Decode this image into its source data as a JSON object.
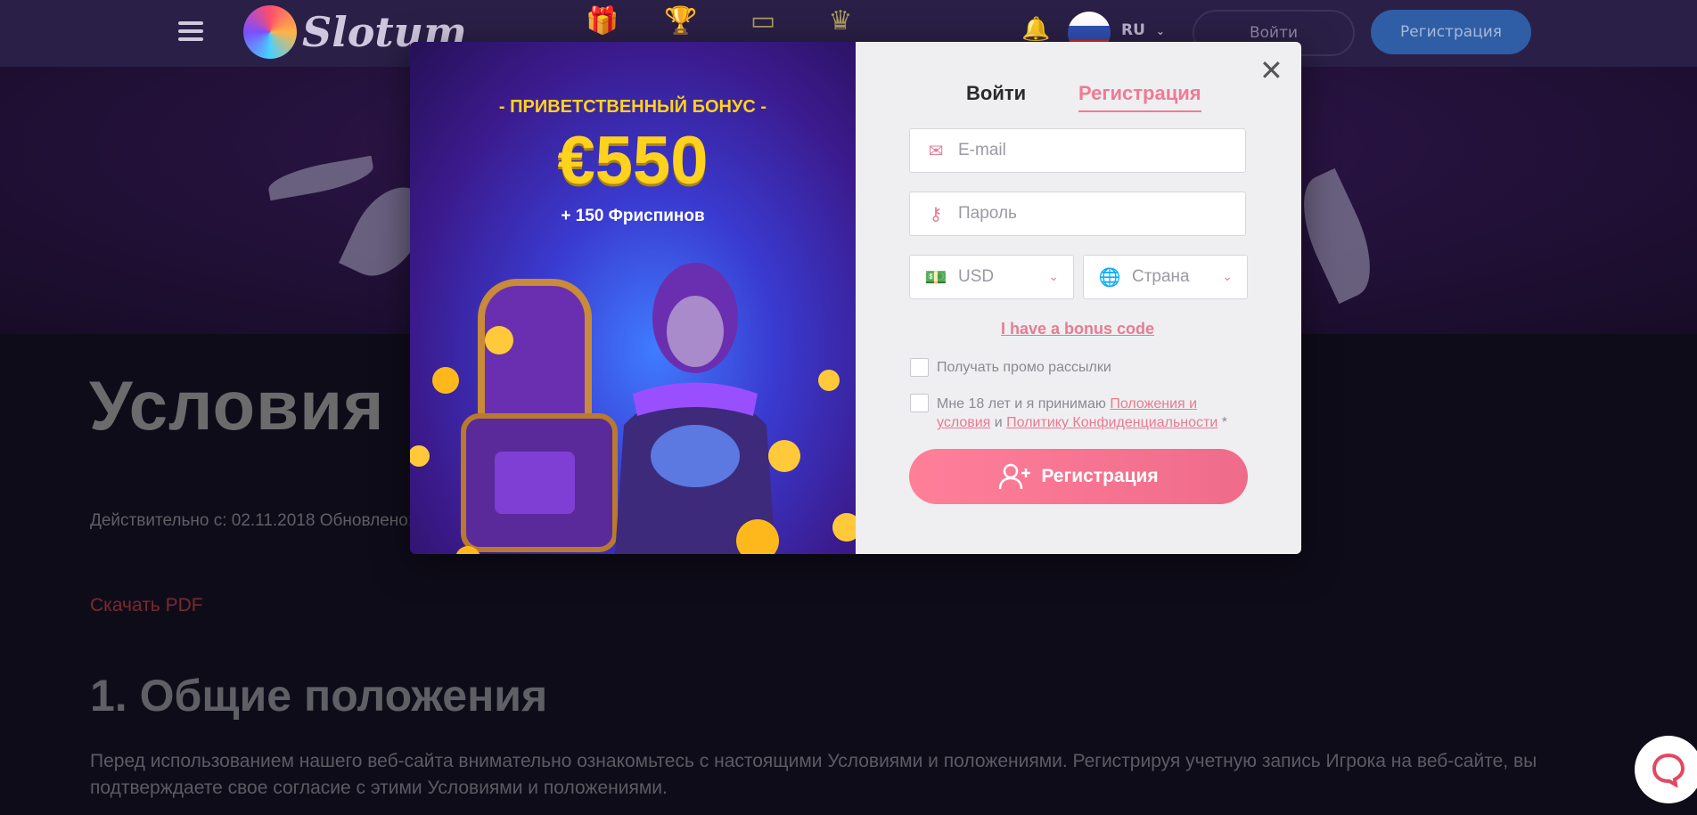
{
  "header": {
    "brand": "Slotum",
    "language": "RU",
    "login_label": "Войти",
    "register_label": "Регистрация"
  },
  "page": {
    "title": "Условия",
    "valid_text": "Действительно с: 02.11.2018 Обновлено:",
    "pdf_link": "Скачать PDF",
    "section_title": "1. Общие положения",
    "paragraph": "Перед использованием нашего веб-сайта внимательно ознакомьтесь с настоящими Условиями и положениями. Регистрируя учетную запись Игрока на веб-сайте, вы подтверждаете свое согласие с этими Условиями и положениями."
  },
  "modal": {
    "promo": {
      "headline": "- ПРИВЕТСТВЕННЫЙ БОНУС -",
      "amount": "€550",
      "spins": "+ 150 Фриспинов"
    },
    "tabs": {
      "login": "Войти",
      "register": "Регистрация"
    },
    "fields": {
      "email_placeholder": "E-mail",
      "password_placeholder": "Пароль",
      "currency_value": "USD",
      "country_placeholder": "Страна"
    },
    "bonus_code_link": "I have a bonus code",
    "promo_checkbox_label": "Получать промо рассылки",
    "terms_prefix": "Мне 18 лет и я принимаю ",
    "terms_link": "Положения и условия",
    "terms_and": " и ",
    "privacy_link": "Политику Конфиденциальности",
    "terms_suffix": " *",
    "submit_label": "Регистрация"
  },
  "colors": {
    "accent": "#f07a93",
    "header_bg": "#2a1f46",
    "promo_yellow": "#ffd21e"
  }
}
